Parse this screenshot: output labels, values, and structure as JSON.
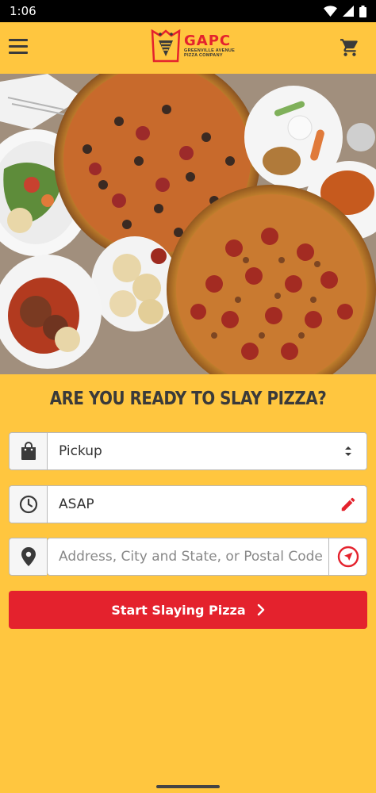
{
  "status_bar": {
    "time": "1:06",
    "icons": [
      "wifi-icon",
      "signal-icon",
      "battery-icon"
    ]
  },
  "header": {
    "logo_name": "GAPC",
    "logo_subtitle_line1": "GREENVILLE AVENUE",
    "logo_subtitle_line2": "PIZZA COMPANY",
    "menu_icon": "hamburger-menu-icon",
    "cart_icon": "cart-icon"
  },
  "hero": {
    "image": "pizza-spread-photo"
  },
  "main": {
    "headline": "ARE YOU READY TO SLAY PIZZA?",
    "order_type": {
      "value": "Pickup",
      "icon": "shopping-bag-icon",
      "action_icon": "select-arrows-icon"
    },
    "time": {
      "value": "ASAP",
      "icon": "clock-icon",
      "action_icon": "edit-pencil-icon"
    },
    "address": {
      "placeholder": "Address, City and State, or Postal Code",
      "value": "",
      "icon": "location-pin-icon",
      "action_icon": "locate-me-icon"
    },
    "cta": {
      "label": "Start Slaying Pizza",
      "icon": "chevron-right-icon"
    }
  },
  "colors": {
    "background": "#FFC63F",
    "accent": "#E4222D",
    "text_dark": "#3A3A3A"
  }
}
